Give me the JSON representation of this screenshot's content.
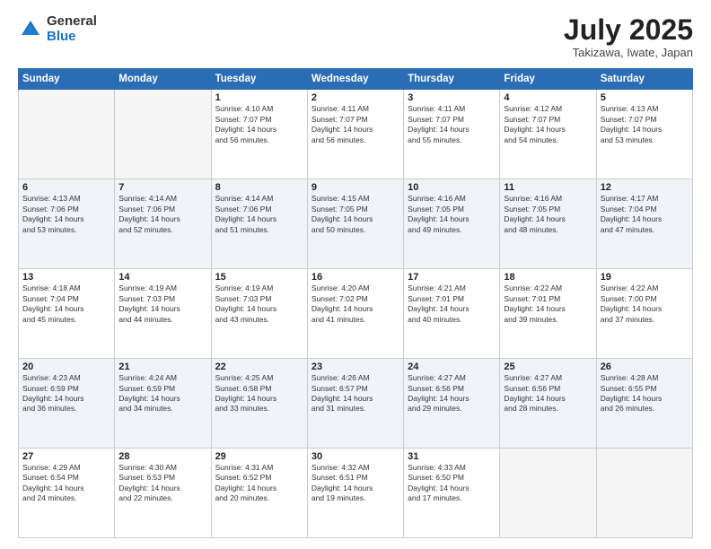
{
  "logo": {
    "general": "General",
    "blue": "Blue"
  },
  "title": "July 2025",
  "location": "Takizawa, Iwate, Japan",
  "headers": [
    "Sunday",
    "Monday",
    "Tuesday",
    "Wednesday",
    "Thursday",
    "Friday",
    "Saturday"
  ],
  "weeks": [
    [
      {
        "day": "",
        "info": ""
      },
      {
        "day": "",
        "info": ""
      },
      {
        "day": "1",
        "info": "Sunrise: 4:10 AM\nSunset: 7:07 PM\nDaylight: 14 hours\nand 56 minutes."
      },
      {
        "day": "2",
        "info": "Sunrise: 4:11 AM\nSunset: 7:07 PM\nDaylight: 14 hours\nand 56 minutes."
      },
      {
        "day": "3",
        "info": "Sunrise: 4:11 AM\nSunset: 7:07 PM\nDaylight: 14 hours\nand 55 minutes."
      },
      {
        "day": "4",
        "info": "Sunrise: 4:12 AM\nSunset: 7:07 PM\nDaylight: 14 hours\nand 54 minutes."
      },
      {
        "day": "5",
        "info": "Sunrise: 4:13 AM\nSunset: 7:07 PM\nDaylight: 14 hours\nand 53 minutes."
      }
    ],
    [
      {
        "day": "6",
        "info": "Sunrise: 4:13 AM\nSunset: 7:06 PM\nDaylight: 14 hours\nand 53 minutes."
      },
      {
        "day": "7",
        "info": "Sunrise: 4:14 AM\nSunset: 7:06 PM\nDaylight: 14 hours\nand 52 minutes."
      },
      {
        "day": "8",
        "info": "Sunrise: 4:14 AM\nSunset: 7:06 PM\nDaylight: 14 hours\nand 51 minutes."
      },
      {
        "day": "9",
        "info": "Sunrise: 4:15 AM\nSunset: 7:05 PM\nDaylight: 14 hours\nand 50 minutes."
      },
      {
        "day": "10",
        "info": "Sunrise: 4:16 AM\nSunset: 7:05 PM\nDaylight: 14 hours\nand 49 minutes."
      },
      {
        "day": "11",
        "info": "Sunrise: 4:16 AM\nSunset: 7:05 PM\nDaylight: 14 hours\nand 48 minutes."
      },
      {
        "day": "12",
        "info": "Sunrise: 4:17 AM\nSunset: 7:04 PM\nDaylight: 14 hours\nand 47 minutes."
      }
    ],
    [
      {
        "day": "13",
        "info": "Sunrise: 4:18 AM\nSunset: 7:04 PM\nDaylight: 14 hours\nand 45 minutes."
      },
      {
        "day": "14",
        "info": "Sunrise: 4:19 AM\nSunset: 7:03 PM\nDaylight: 14 hours\nand 44 minutes."
      },
      {
        "day": "15",
        "info": "Sunrise: 4:19 AM\nSunset: 7:03 PM\nDaylight: 14 hours\nand 43 minutes."
      },
      {
        "day": "16",
        "info": "Sunrise: 4:20 AM\nSunset: 7:02 PM\nDaylight: 14 hours\nand 41 minutes."
      },
      {
        "day": "17",
        "info": "Sunrise: 4:21 AM\nSunset: 7:01 PM\nDaylight: 14 hours\nand 40 minutes."
      },
      {
        "day": "18",
        "info": "Sunrise: 4:22 AM\nSunset: 7:01 PM\nDaylight: 14 hours\nand 39 minutes."
      },
      {
        "day": "19",
        "info": "Sunrise: 4:22 AM\nSunset: 7:00 PM\nDaylight: 14 hours\nand 37 minutes."
      }
    ],
    [
      {
        "day": "20",
        "info": "Sunrise: 4:23 AM\nSunset: 6:59 PM\nDaylight: 14 hours\nand 36 minutes."
      },
      {
        "day": "21",
        "info": "Sunrise: 4:24 AM\nSunset: 6:59 PM\nDaylight: 14 hours\nand 34 minutes."
      },
      {
        "day": "22",
        "info": "Sunrise: 4:25 AM\nSunset: 6:58 PM\nDaylight: 14 hours\nand 33 minutes."
      },
      {
        "day": "23",
        "info": "Sunrise: 4:26 AM\nSunset: 6:57 PM\nDaylight: 14 hours\nand 31 minutes."
      },
      {
        "day": "24",
        "info": "Sunrise: 4:27 AM\nSunset: 6:56 PM\nDaylight: 14 hours\nand 29 minutes."
      },
      {
        "day": "25",
        "info": "Sunrise: 4:27 AM\nSunset: 6:56 PM\nDaylight: 14 hours\nand 28 minutes."
      },
      {
        "day": "26",
        "info": "Sunrise: 4:28 AM\nSunset: 6:55 PM\nDaylight: 14 hours\nand 26 minutes."
      }
    ],
    [
      {
        "day": "27",
        "info": "Sunrise: 4:29 AM\nSunset: 6:54 PM\nDaylight: 14 hours\nand 24 minutes."
      },
      {
        "day": "28",
        "info": "Sunrise: 4:30 AM\nSunset: 6:53 PM\nDaylight: 14 hours\nand 22 minutes."
      },
      {
        "day": "29",
        "info": "Sunrise: 4:31 AM\nSunset: 6:52 PM\nDaylight: 14 hours\nand 20 minutes."
      },
      {
        "day": "30",
        "info": "Sunrise: 4:32 AM\nSunset: 6:51 PM\nDaylight: 14 hours\nand 19 minutes."
      },
      {
        "day": "31",
        "info": "Sunrise: 4:33 AM\nSunset: 6:50 PM\nDaylight: 14 hours\nand 17 minutes."
      },
      {
        "day": "",
        "info": ""
      },
      {
        "day": "",
        "info": ""
      }
    ]
  ]
}
